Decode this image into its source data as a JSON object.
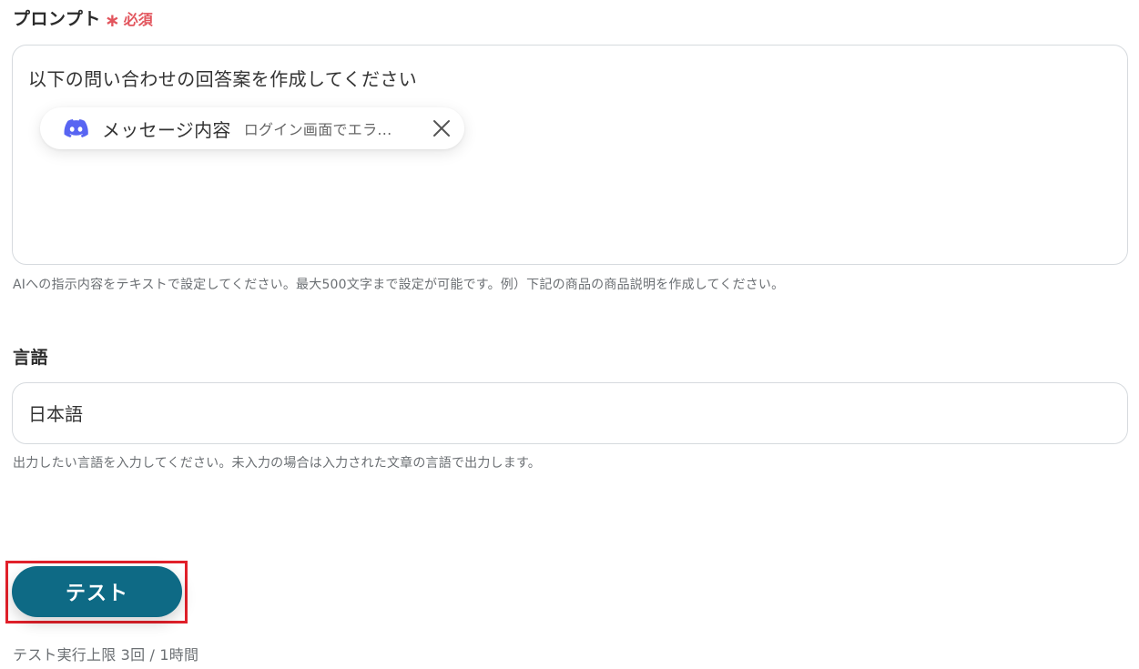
{
  "prompt_field": {
    "label": "プロンプト",
    "required_mark": "∗",
    "required_text": "必須",
    "text": "以下の問い合わせの回答案を作成してください",
    "chip": {
      "icon": "discord-icon",
      "name": "メッセージ内容",
      "value": "ログイン画面でエラ..."
    },
    "hint": "AIへの指示内容をテキストで設定してください。最大500文字まで設定が可能です。例）下記の商品の商品説明を作成してください。"
  },
  "language_field": {
    "label": "言語",
    "value": "日本語",
    "hint": "出力したい言語を入力してください。未入力の場合は入力された文章の言語で出力します。"
  },
  "test_button": {
    "label": "テスト"
  },
  "limit_text": "テスト実行上限 3回 / 1時間",
  "colors": {
    "accent": "#0e6a85",
    "required": "#e2555d",
    "highlight": "#e1202a",
    "discord": "#5865f2"
  }
}
